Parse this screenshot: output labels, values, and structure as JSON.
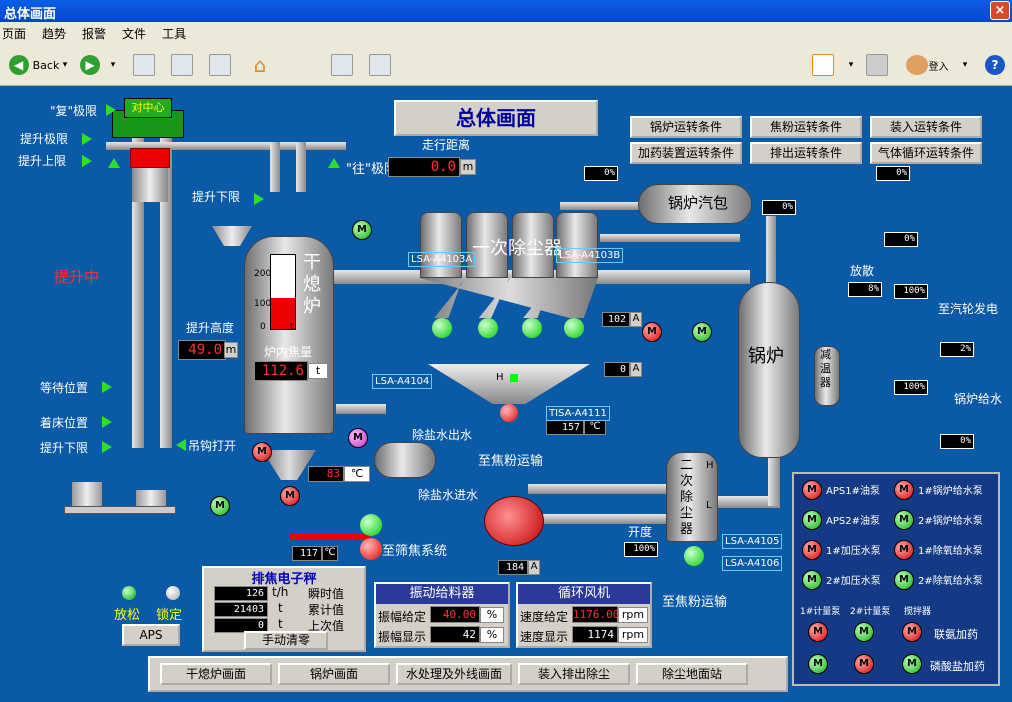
{
  "window": {
    "title": "总体画面",
    "close": "×"
  },
  "menu": [
    "页面",
    "趋势",
    "报警",
    "文件",
    "工具"
  ],
  "toolbar": {
    "back": "Back",
    "user_label": "登入"
  },
  "main": {
    "title": "总体画面",
    "coke_car_label": "对中心",
    "fu_limit": "\"复\"极限",
    "wang_limit": "\"往\"极限",
    "lift_upper_limit": "提升极限",
    "lift_upper": "提升上限",
    "lift_lower_small": "提升下限",
    "lifting": "提升中",
    "lift_height": "提升高度",
    "lift_height_value": "49.0",
    "lift_height_unit": "m",
    "travel_distance": "走行距离",
    "travel_distance_value": "0.0",
    "travel_distance_unit": "m",
    "wait_position": "等待位置",
    "seat_position": "着床位置",
    "lift_lower": "提升下限",
    "hook_open": "吊钩打开",
    "dry_quench_furnace": "干熄炉",
    "furnace_coke": "炉内焦量",
    "furnace_coke_value": "112.6",
    "furnace_coke_unit": "t",
    "gauge_scale": [
      "200",
      "100",
      "0"
    ],
    "gauge_unit": "t",
    "primary_dust": "一次除尘器",
    "secondary_dust": "二次除尘器",
    "boiler_drum": "锅炉汽包",
    "boiler": "锅炉",
    "desuperheater": "减温器",
    "blowdown": "放散",
    "to_turbine": "至汽轮发电",
    "boiler_feed": "锅炉给水",
    "desalt_out": "除盐水出水",
    "desalt_in": "除盐水进水",
    "to_powder1": "至焦粉运输",
    "to_powder2": "至焦粉运输",
    "to_screen": "至筛焦系统",
    "opening": "开度",
    "temp_83": "83",
    "temp_83_unit": "℃",
    "temp_117": "117",
    "temp_117_unit": "℃",
    "temp_157": "157",
    "temp_157_unit": "℃",
    "amp_102": "102",
    "amp_102_unit": "A",
    "amp_0": "0",
    "amp_0_unit": "A",
    "amp_184": "184",
    "amp_184_unit": "A",
    "tags": {
      "lsa4103a": "LSA-A4103A",
      "lsa4103b": "LSA-A4103B",
      "lsa4104": "LSA-A4104",
      "tisa4111": "TISA-A4111",
      "lsa4105": "LSA-A4105",
      "lsa4106": "LSA-A4106"
    },
    "pct": {
      "p1": "0%",
      "p2": "0%",
      "p3": "0%",
      "p4": "0%",
      "p5": "8%",
      "p6": "100%",
      "p7": "2%",
      "p8": "100%",
      "p9": "0%",
      "p10": "100%"
    },
    "hl": {
      "h": "H",
      "l": "L"
    }
  },
  "conditions": [
    "锅炉运转条件",
    "焦粉运转条件",
    "装入运转条件",
    "加药装置运转条件",
    "排出运转条件",
    "气体循环运转条件"
  ],
  "weigher": {
    "title": "排焦电子秤",
    "rows": [
      {
        "value": "126",
        "unit": "t/h",
        "label": "瞬时值"
      },
      {
        "value": "21403",
        "unit": "t",
        "label": "累计值"
      },
      {
        "value": "0",
        "unit": "t",
        "label": "上次值"
      }
    ],
    "clear": "手动清零"
  },
  "aps": {
    "relax": "放松",
    "lock": "锁定",
    "button": "APS"
  },
  "vibro": {
    "title": "振动给料器",
    "rows": [
      {
        "label": "振幅给定",
        "value": "40.00",
        "unit": "%"
      },
      {
        "label": "振幅显示",
        "value": "42",
        "unit": "%"
      }
    ]
  },
  "fan": {
    "title": "循环风机",
    "rows": [
      {
        "label": "速度给定",
        "value": "1176.00",
        "unit": "rpm"
      },
      {
        "label": "速度显示",
        "value": "1174",
        "unit": "rpm"
      }
    ]
  },
  "nav": [
    "干熄炉画面",
    "锅炉画面",
    "水处理及外线画面",
    "装入排出除尘",
    "除尘地面站"
  ],
  "legend": {
    "items": [
      {
        "motor": "M",
        "color": "red",
        "label": "APS1#油泵"
      },
      {
        "motor": "M",
        "color": "red",
        "label": "1#锅炉给水泵"
      },
      {
        "motor": "M",
        "color": "green",
        "label": "APS2#油泵"
      },
      {
        "motor": "M",
        "color": "green",
        "label": "2#锅炉给水泵"
      },
      {
        "motor": "M",
        "color": "red",
        "label": "1#加压水泵"
      },
      {
        "motor": "M",
        "color": "red",
        "label": "1#除氧给水泵"
      },
      {
        "motor": "M",
        "color": "green",
        "label": "2#加压水泵"
      },
      {
        "motor": "M",
        "color": "green",
        "label": "2#除氧给水泵"
      }
    ],
    "pump_labels": [
      "1#计量泵",
      "2#计量泵",
      "搅拌器"
    ],
    "ammonia": "联氨加药",
    "phosphate": "磷酸盐加药"
  },
  "motor_letter": "M"
}
